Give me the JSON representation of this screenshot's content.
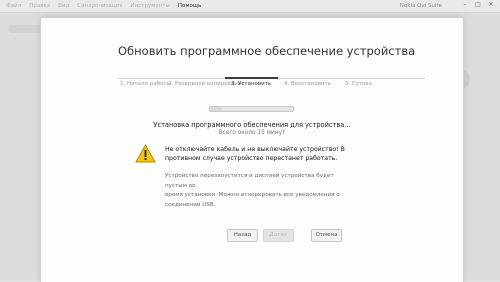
{
  "menu": {
    "items": [
      "Файл",
      "Правка",
      "Вид",
      "Синхронизация",
      "Инструменты",
      "Помощь"
    ],
    "active_index": 5
  },
  "app_title": "Nokia Ovi Suite",
  "window_controls": {
    "minimize": "–",
    "maximize": "□",
    "close": "✕"
  },
  "dialog": {
    "title": "Обновить программное обеспечение устройства",
    "steps": [
      "1. Начало работы",
      "2. Резервное копирование",
      "3. Установить",
      "4. Восстановить",
      "5. Готово"
    ],
    "active_step": 2,
    "progress_fraction": 0.15,
    "heading": "Установка программного обеспечения для устройства...",
    "subheading": "Всего около 15 минут",
    "warning_line1": "Не отключайте кабель и не выключайте устройство! В",
    "warning_line2": "противном случае устройство перестанет работать.",
    "info_line1": "Устройство перезапустится и дисплей устройства будет пустым во",
    "info_line2": "время установки. Можно игнорировать все уведомления о",
    "info_line3": "соединении USB.",
    "buttons": {
      "back": "Назад",
      "next": "Далее",
      "cancel": "Отмена"
    },
    "colors": {
      "warning_fill": "#f4c21b",
      "warning_stroke": "#b88a00"
    },
    "warning_icon": "warning-triangle"
  }
}
